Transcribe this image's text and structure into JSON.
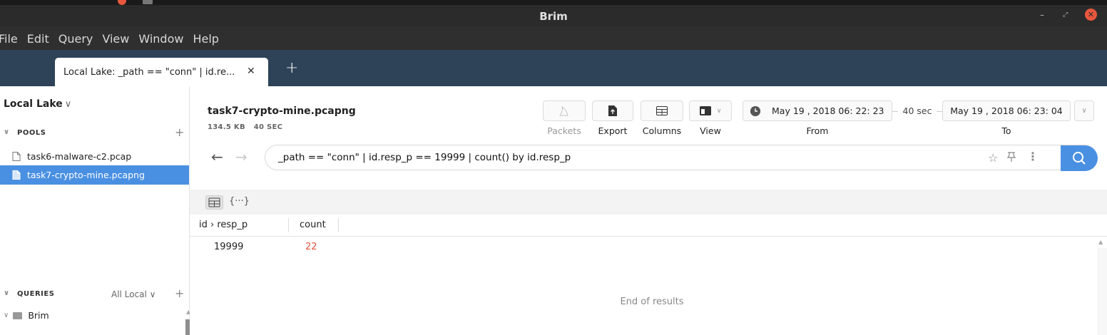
{
  "window": {
    "title": "Brim"
  },
  "menu": [
    "File",
    "Edit",
    "Query",
    "View",
    "Window",
    "Help"
  ],
  "tab": {
    "label": "Local Lake: _path == \"conn\" | id.re...",
    "close": "✕",
    "new_tab": "+"
  },
  "sidebar": {
    "lake": "Local Lake",
    "pools_header": "POOLS",
    "pools": [
      {
        "name": "task6-malware-c2.pcap",
        "selected": false
      },
      {
        "name": "task7-crypto-mine.pcapng",
        "selected": true
      }
    ],
    "queries_header": "QUERIES",
    "queries_scope": "All Local",
    "tree_root": "Brim"
  },
  "header": {
    "pool_name": "task7-crypto-mine.pcapng",
    "pool_size": "134.5 KB",
    "pool_duration": "40 SEC"
  },
  "toolbar": {
    "packets": "Packets",
    "export": "Export",
    "columns": "Columns",
    "view": "View",
    "from_value": "May 19 , 2018  06: 22: 23",
    "duration": "40 sec",
    "to_value": "May 19 , 2018  06: 23: 04",
    "from_label": "From",
    "to_label": "To"
  },
  "search": {
    "query": "_path == \"conn\" | id.resp_p == 19999 | count() by id.resp_p"
  },
  "results": {
    "json_toggle": "{···}",
    "columns": [
      "id › resp_p",
      "count"
    ],
    "rows": [
      {
        "resp_p": "19999",
        "count": "22"
      }
    ],
    "end_text": "End of results"
  },
  "colors": {
    "accent": "#4a90e2",
    "tabbar": "#2e4258",
    "count_value": "#e8573d",
    "close_button": "#e8573d"
  }
}
